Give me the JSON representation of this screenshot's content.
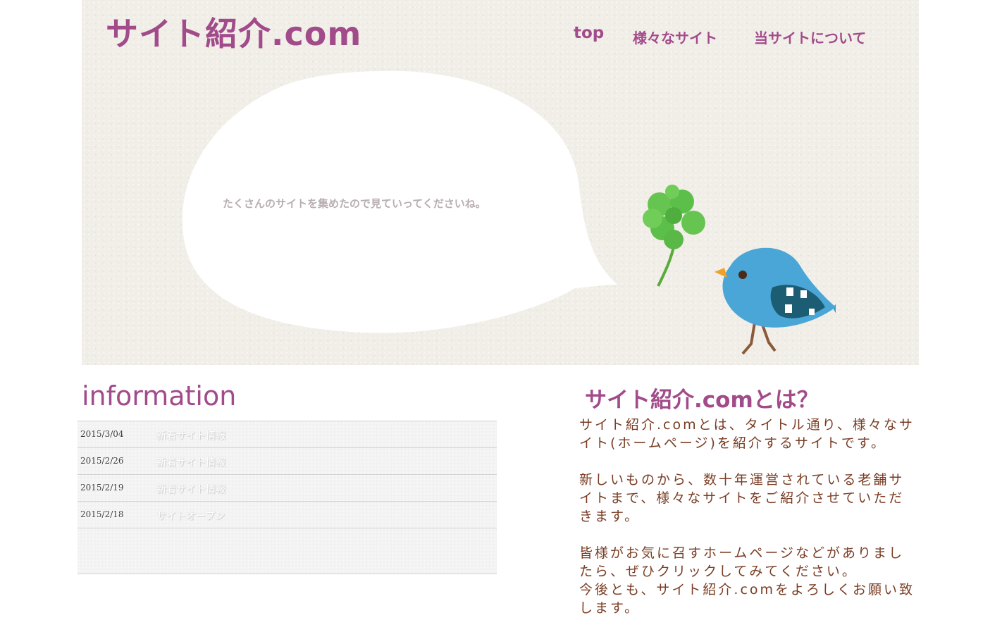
{
  "site": {
    "logo": "サイト紹介.com",
    "nav": {
      "top": "top",
      "sites": "様々なサイト",
      "about": "当サイトについて"
    },
    "bubble_text": "たくさんのサイトを集めたので見ていってくださいね。"
  },
  "information": {
    "title": "information",
    "items": [
      {
        "date": "2015/3/04",
        "text": "新着サイト情報"
      },
      {
        "date": "2015/2/26",
        "text": "新着サイト情報"
      },
      {
        "date": "2015/2/19",
        "text": "新着サイト情報"
      },
      {
        "date": "2015/2/18",
        "text": "サイトオープン"
      }
    ]
  },
  "about": {
    "title": "サイト紹介.comとは？",
    "paragraphs": [
      "サイト紹介.comとは、タイトル通り、様々なサイト(ホームページ)を紹介するサイトです。",
      "新しいものから、数十年運営されている老舗サイトまで、様々なサイトをご紹介させていただきます。",
      "皆様がお気に召すホームページなどがありましたら、ぜひクリックしてみてください。",
      "今後とも、サイト紹介.comをよろしくお願い致します。"
    ]
  },
  "colors": {
    "brand": "#a24b8a",
    "body_text": "#7a3d24",
    "hero_bg": "#f1eee8",
    "bird_blue": "#4aa6d6",
    "clover_green": "#5cbf4a"
  },
  "icons": [
    "speech-bubble-icon",
    "bird-illustration",
    "clover-icon"
  ]
}
